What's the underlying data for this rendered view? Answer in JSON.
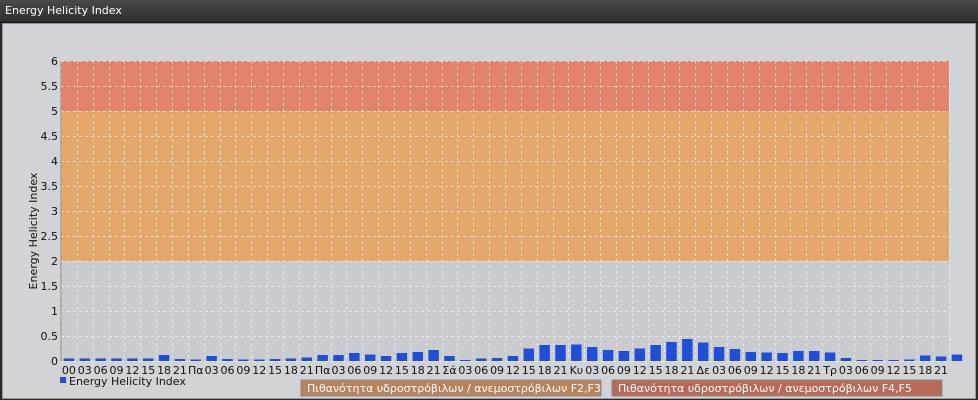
{
  "window": {
    "title": "Energy Helicity Index"
  },
  "chart_data": {
    "type": "bar",
    "title": "",
    "ylabel": "Energy Helicity Index",
    "xlabel": "",
    "ylim": [
      0,
      6
    ],
    "yticks": [
      "0",
      "0.5",
      "1",
      "1.5",
      "2",
      "2.5",
      "3",
      "3.5",
      "4",
      "4.5",
      "5",
      "5.5",
      "6"
    ],
    "grid": true,
    "legend_placement": "bottom-left",
    "categories": [
      "00",
      "03",
      "06",
      "09",
      "12",
      "15",
      "18",
      "21",
      "Πα",
      "03",
      "06",
      "09",
      "12",
      "15",
      "18",
      "21",
      "Πα",
      "03",
      "06",
      "09",
      "12",
      "15",
      "18",
      "21",
      "Σά",
      "03",
      "06",
      "09",
      "12",
      "15",
      "18",
      "21",
      "Κυ",
      "03",
      "06",
      "09",
      "12",
      "15",
      "18",
      "21",
      "Δε",
      "03",
      "06",
      "09",
      "12",
      "15",
      "18",
      "21",
      "Τρ",
      "03",
      "06",
      "09",
      "12",
      "15",
      "18",
      "21"
    ],
    "series": [
      {
        "name": "Energy Helicity Index",
        "color": "#1f4fd6",
        "values": [
          0.05,
          0.05,
          0.05,
          0.05,
          0.05,
          0.05,
          0.12,
          0.04,
          0.03,
          0.1,
          0.04,
          0.03,
          0.03,
          0.04,
          0.05,
          0.07,
          0.12,
          0.12,
          0.16,
          0.13,
          0.1,
          0.16,
          0.18,
          0.22,
          0.1,
          0.02,
          0.05,
          0.06,
          0.1,
          0.25,
          0.32,
          0.32,
          0.33,
          0.28,
          0.22,
          0.2,
          0.25,
          0.32,
          0.38,
          0.44,
          0.37,
          0.28,
          0.24,
          0.18,
          0.17,
          0.16,
          0.2,
          0.2,
          0.17,
          0.06,
          0.02,
          0.02,
          0.02,
          0.03,
          0.11,
          0.09,
          0.13
        ]
      }
    ],
    "bands": [
      {
        "from": 0,
        "to": 2,
        "color": "#c9cbce"
      },
      {
        "from": 2,
        "to": 5,
        "color": "#e4a76b"
      },
      {
        "from": 5,
        "to": 6,
        "color": "#e2836b"
      }
    ],
    "band_labels": [
      {
        "text": "Πιθανότητα υδροστρόβιλων / ανεμοστρόβιλων F2,F3",
        "color": "#b7835c"
      },
      {
        "text": "Πιθανότητα υδροστρόβιλων / ανεμοστρόβιλων F4,F5",
        "color": "#b86a5a"
      }
    ]
  }
}
